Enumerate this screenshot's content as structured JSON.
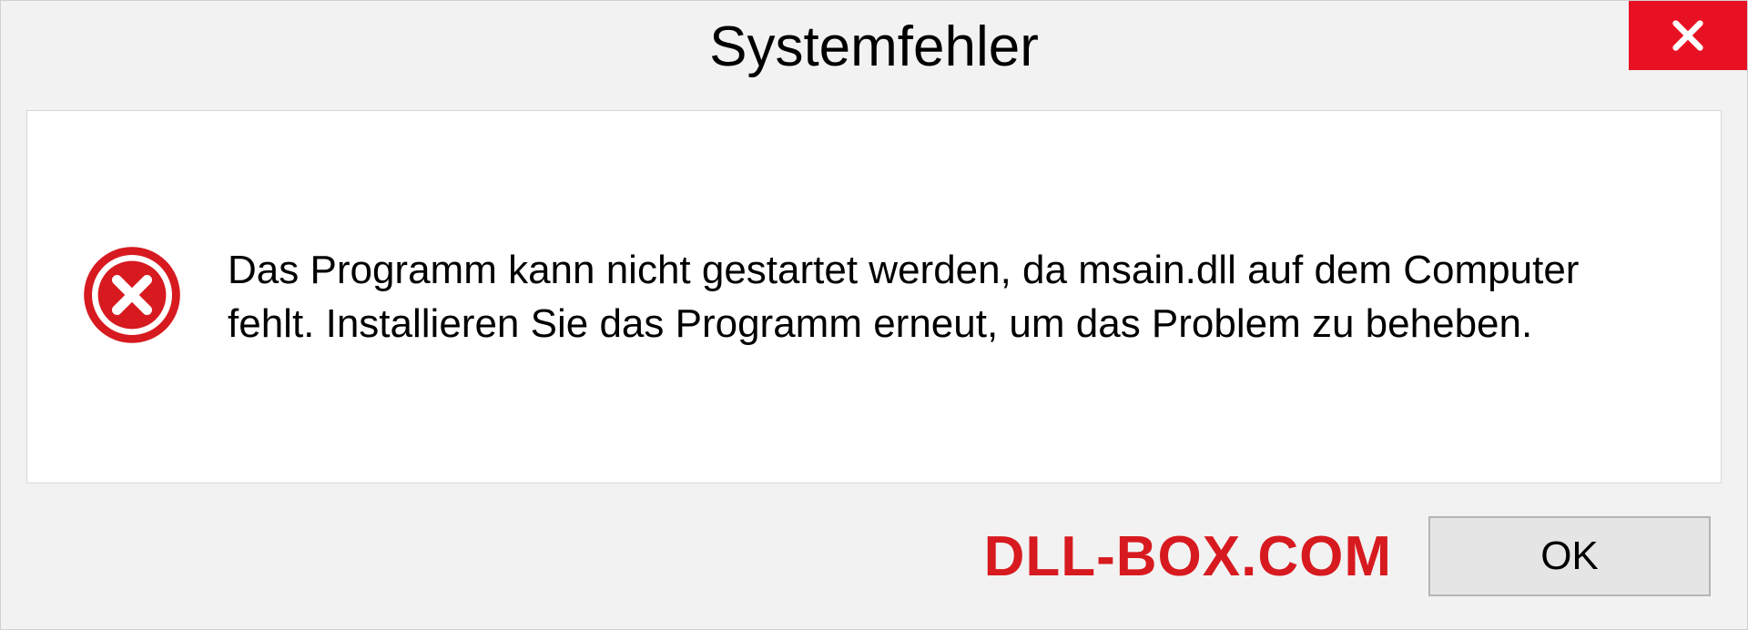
{
  "dialog": {
    "title": "Systemfehler",
    "message": "Das Programm kann nicht gestartet werden, da msain.dll auf dem Computer fehlt. Installieren Sie das Programm erneut, um das Problem zu beheben.",
    "ok_label": "OK"
  },
  "watermark": "DLL-BOX.COM"
}
